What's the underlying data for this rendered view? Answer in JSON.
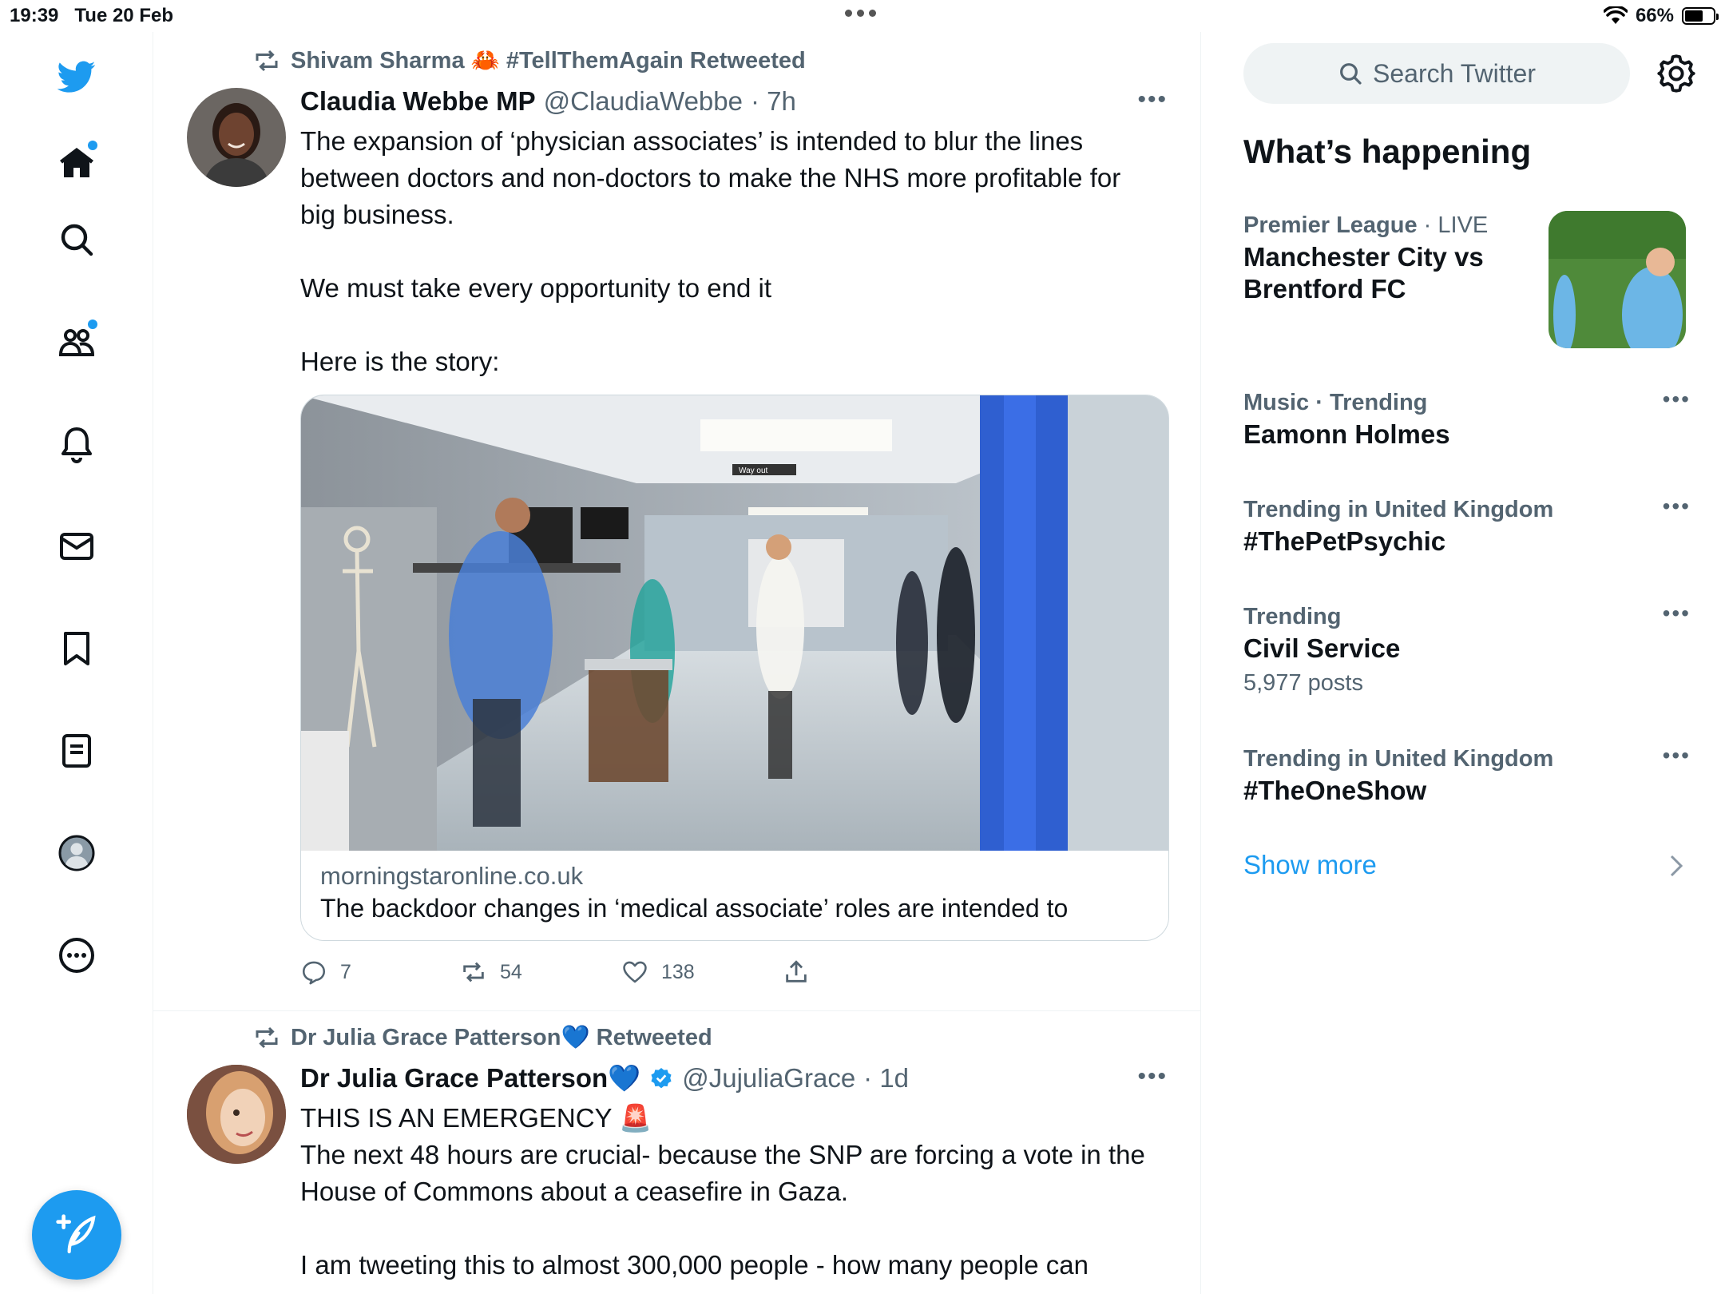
{
  "status_bar": {
    "time": "19:39",
    "date": "Tue 20 Feb",
    "battery": "66%",
    "battery_level": 0.66
  },
  "nav": {
    "items": [
      "twitter-logo",
      "home-icon",
      "search-icon",
      "communities-icon",
      "notifications-icon",
      "messages-icon",
      "bookmarks-icon",
      "lists-icon",
      "profile-icon",
      "more-icon"
    ],
    "compose_icon": "compose-icon"
  },
  "tweets": [
    {
      "retweeted_by": "Shivam Sharma 🦀 #TellThemAgain Retweeted",
      "name": "Claudia Webbe MP",
      "handle": "@ClaudiaWebbe",
      "time": "· 7h",
      "text": "The expansion of ‘physician associates’ is intended to blur the lines between doctors and non-doctors to make the NHS more profitable for big business.\n\nWe must take every opportunity to end it\n\nHere is the story:",
      "card": {
        "domain": "morningstaronline.co.uk",
        "title": "The backdoor changes in ‘medical associate’ roles are intended to",
        "image_sign": "Way out"
      },
      "replies": "7",
      "retweets": "54",
      "likes": "138"
    },
    {
      "retweeted_by": "Dr Julia Grace Patterson💙 Retweeted",
      "name": "Dr Julia Grace Patterson💙",
      "handle": "@JujuliaGrace",
      "time": "· 1d",
      "text": "THIS IS AN EMERGENCY 🚨\nThe next 48 hours are crucial- because the SNP are forcing a vote in the House of Commons about a ceasefire in Gaza.\n\nI am tweeting this to almost 300,000 people - how many people can"
    }
  ],
  "right": {
    "search_placeholder": "Search Twitter",
    "whats_happening": "What’s happening",
    "trends": [
      {
        "meta": "Premier League",
        "meta_extra": " · LIVE",
        "name": "Manchester City vs Brentford FC",
        "posts": ""
      },
      {
        "meta": "Music · Trending",
        "meta_extra": "",
        "name": "Eamonn Holmes",
        "posts": ""
      },
      {
        "meta": "Trending in United Kingdom",
        "meta_extra": "",
        "name": "#ThePetPsychic",
        "posts": ""
      },
      {
        "meta": "Trending",
        "meta_extra": "",
        "name": "Civil Service",
        "posts": "5,977 posts"
      },
      {
        "meta": "Trending in United Kingdom",
        "meta_extra": "",
        "name": "#TheOneShow",
        "posts": ""
      }
    ],
    "show_more": "Show more"
  },
  "colors": {
    "accent": "#1d9bf0",
    "text": "#0f1419",
    "muted": "#536471"
  }
}
